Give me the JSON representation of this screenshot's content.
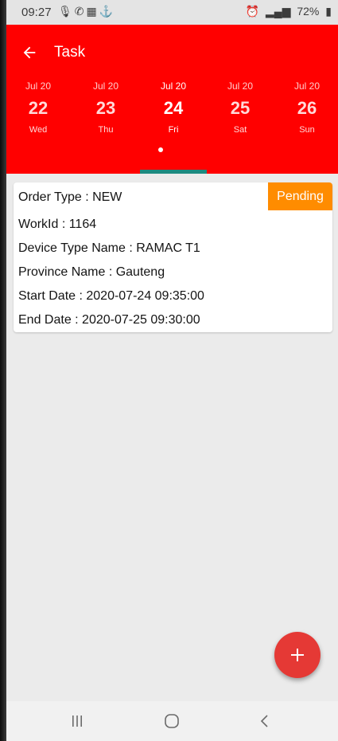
{
  "status_bar": {
    "time": "09:27",
    "left_icons": [
      "mic-icon",
      "whatsapp-icon",
      "app-icon",
      "usb-icon"
    ],
    "right_icons": [
      "alarm-icon",
      "volte-icon",
      "4g-icon",
      "signal-icon"
    ],
    "battery": "72%"
  },
  "app_bar": {
    "title": "Task"
  },
  "calendar": {
    "days": [
      {
        "month": "Jul 20",
        "date": "22",
        "weekday": "Wed"
      },
      {
        "month": "Jul 20",
        "date": "23",
        "weekday": "Thu"
      },
      {
        "month": "Jul 20",
        "date": "24",
        "weekday": "Fri"
      },
      {
        "month": "Jul 20",
        "date": "25",
        "weekday": "Sat"
      },
      {
        "month": "Jul 20",
        "date": "26",
        "weekday": "Sun"
      }
    ],
    "selected_index": 2
  },
  "task": {
    "order_type": "Order Type : NEW",
    "status": "Pending",
    "work_id": "WorkId : 1164",
    "device_type": "Device Type Name : RAMAC T1",
    "province": "Province Name : Gauteng",
    "start_date": "Start Date : 2020-07-24 09:35:00",
    "end_date": "End Date : 2020-07-25 09:30:00"
  },
  "fab": {
    "icon": "plus-icon"
  },
  "nav": {
    "icons": [
      "recent-apps-icon",
      "home-icon",
      "back-icon"
    ]
  },
  "colors": {
    "app_bar": "#ff0000",
    "status_badge": "#ff8c00",
    "fab": "#e53935",
    "tab_indicator": "#1d8a80"
  }
}
